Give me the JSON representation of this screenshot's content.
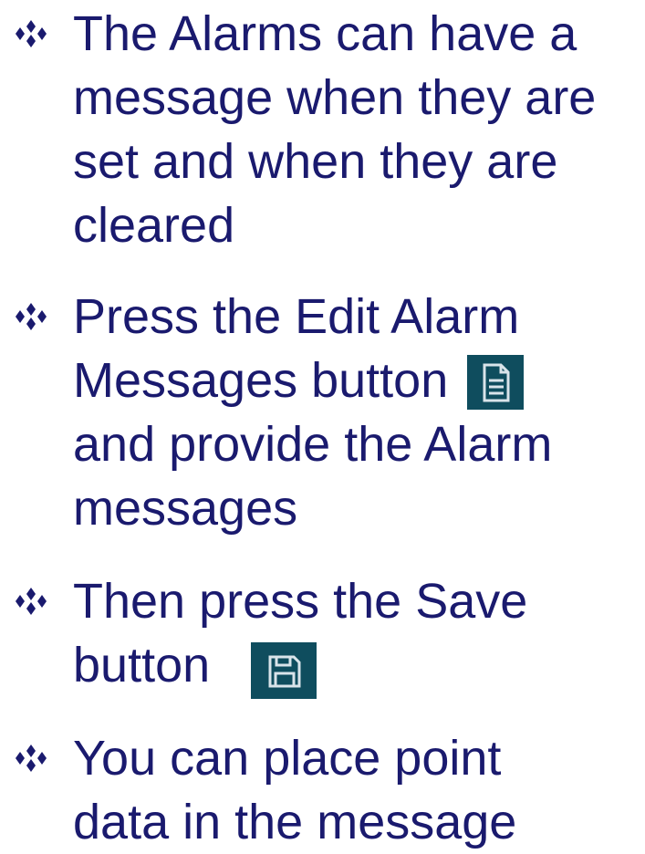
{
  "colors": {
    "text": "#1a1a6e",
    "bullet": "#1a1a6e",
    "icon_bg": "#0f4d5e",
    "icon_fg": "#d9e4ea"
  },
  "bullets": [
    {
      "lines": [
        "The Alarms can have a",
        "message when they are",
        "set and when they are",
        "cleared"
      ]
    },
    {
      "lines": [
        "Press the Edit Alarm",
        "Messages button",
        "and provide the Alarm",
        "messages"
      ],
      "icon": "edit-alarm-messages-icon"
    },
    {
      "lines": [
        "Then press the Save",
        "button"
      ],
      "icon": "save-icon"
    },
    {
      "lines": [
        "You can place point",
        "data in the message"
      ]
    }
  ]
}
